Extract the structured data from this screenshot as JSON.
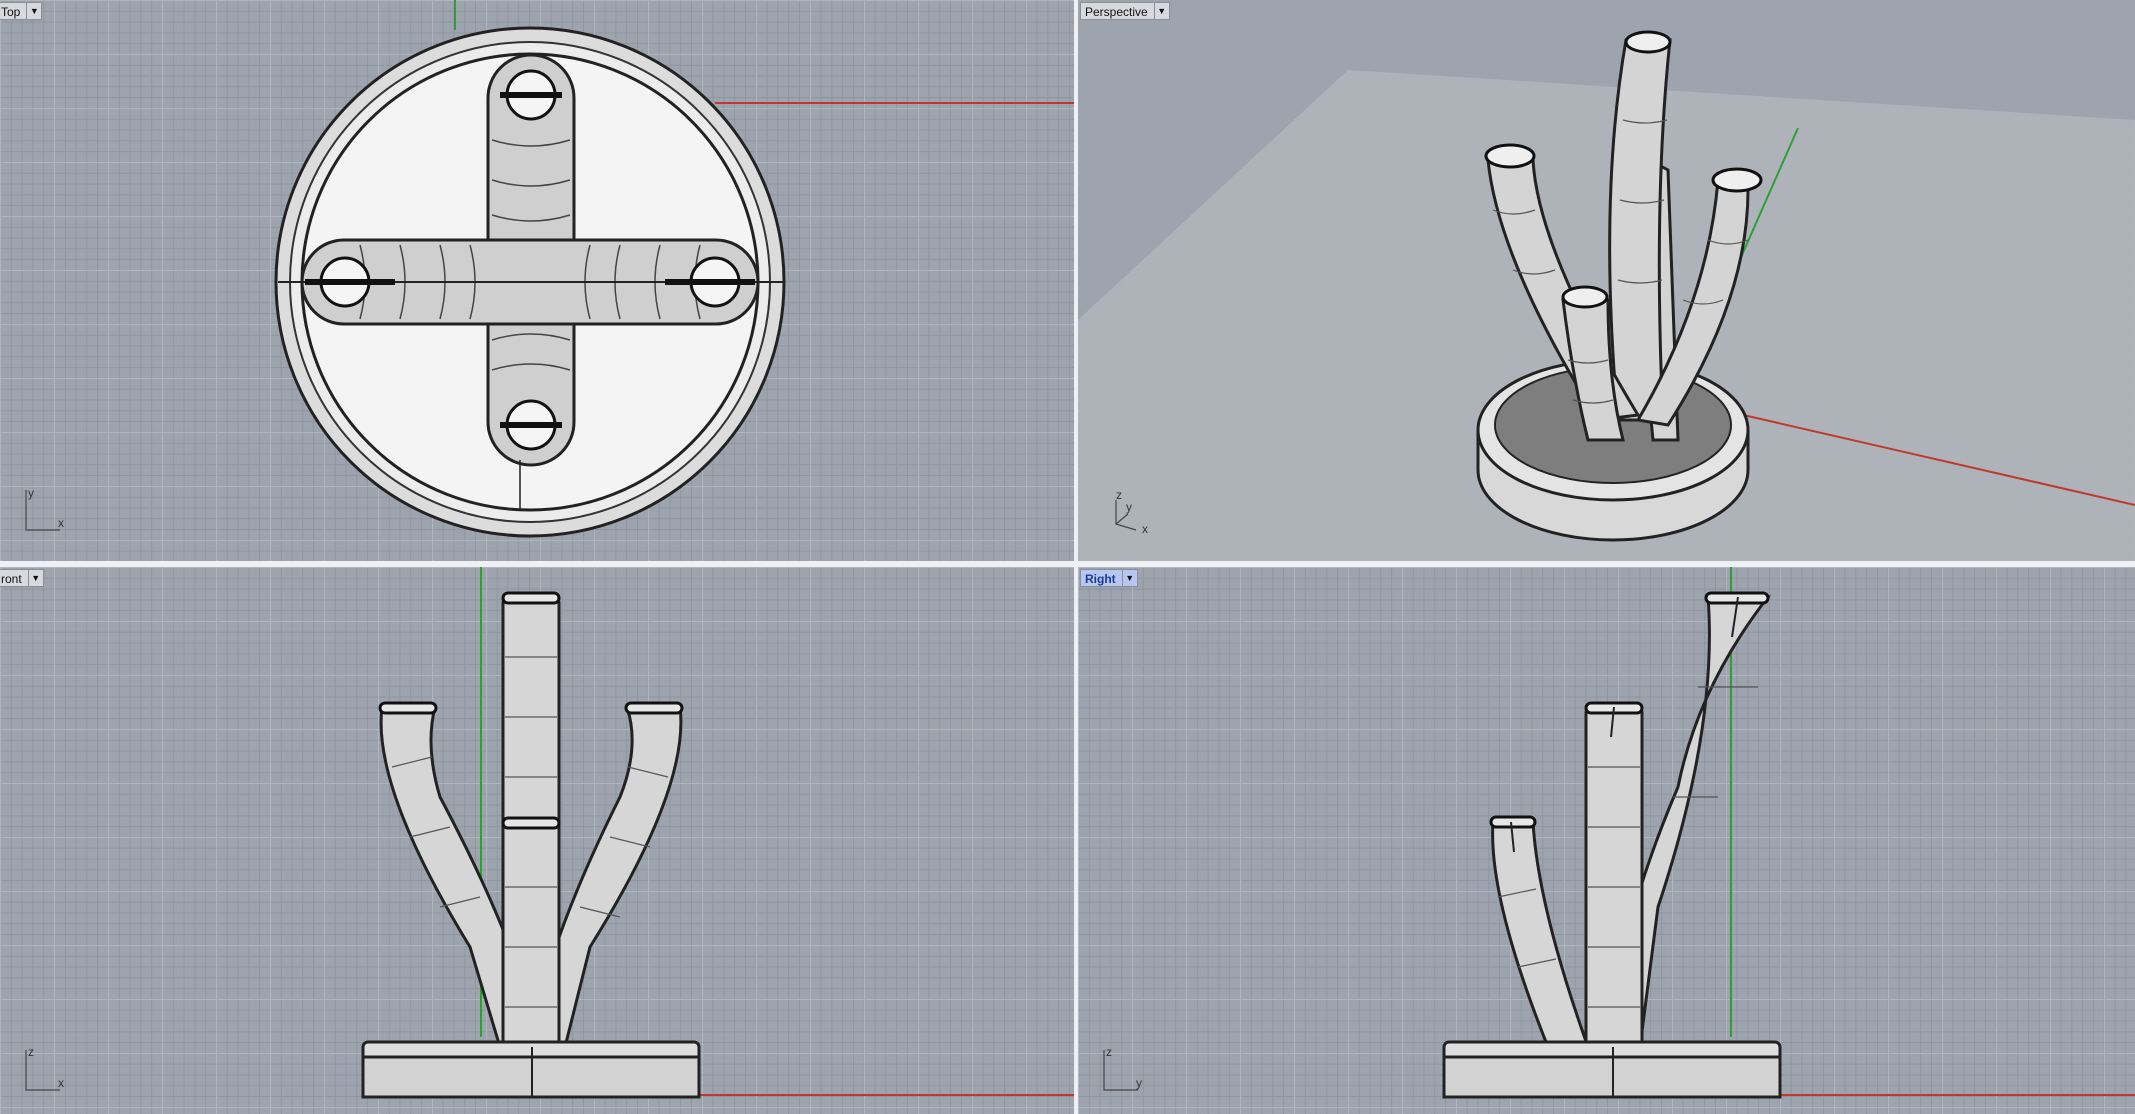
{
  "viewports": {
    "top": {
      "label": "Top",
      "display": "Top"
    },
    "perspective": {
      "label": "Perspective"
    },
    "front": {
      "label": "Front",
      "display": "ront"
    },
    "right": {
      "label": "Right"
    }
  },
  "axes": {
    "top": {
      "a": "y",
      "b": "x"
    },
    "perspective": {
      "a": "z",
      "b": "y",
      "c": "x"
    },
    "front": {
      "a": "z",
      "b": "x"
    },
    "right": {
      "a": "z",
      "b": "y"
    }
  },
  "icons": {
    "dropdown": "chevron-down-icon"
  },
  "colors": {
    "background": "#9ea4ad",
    "x_axis": "#c0392b",
    "y_axis": "#2e9e35",
    "active_tab": "#b8c7f2"
  }
}
